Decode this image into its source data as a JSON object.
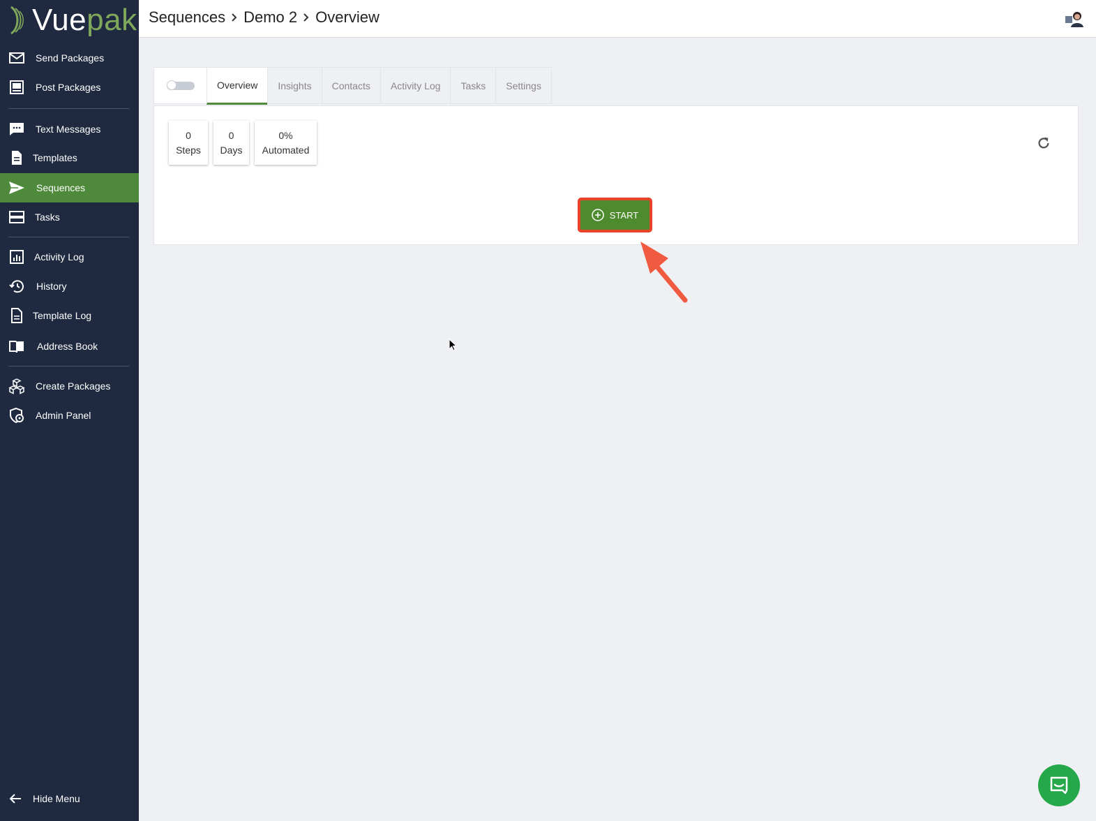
{
  "brand": {
    "part1": "Vue",
    "part2": "pak"
  },
  "sidebar": {
    "items": [
      {
        "label": "Send Packages",
        "icon": "mail-icon"
      },
      {
        "label": "Post Packages",
        "icon": "post-icon"
      },
      {
        "label": "Text Messages",
        "icon": "chat-bubble-icon"
      },
      {
        "label": "Templates",
        "icon": "document-icon"
      },
      {
        "label": "Sequences",
        "icon": "send-icon",
        "active": true
      },
      {
        "label": "Tasks",
        "icon": "tasks-icon"
      },
      {
        "label": "Activity Log",
        "icon": "chart-icon"
      },
      {
        "label": "History",
        "icon": "history-icon"
      },
      {
        "label": "Template Log",
        "icon": "document-outline-icon"
      },
      {
        "label": "Address Book",
        "icon": "book-icon"
      },
      {
        "label": "Create Packages",
        "icon": "boxes-icon"
      },
      {
        "label": "Admin Panel",
        "icon": "admin-shield-icon"
      }
    ],
    "hide_menu": "Hide Menu"
  },
  "breadcrumb": [
    "Sequences",
    "Demo 2",
    "Overview"
  ],
  "tabs": [
    "Overview",
    "Insights",
    "Contacts",
    "Activity Log",
    "Tasks",
    "Settings"
  ],
  "stats": [
    {
      "value": "0",
      "label": "Steps"
    },
    {
      "value": "0",
      "label": "Days"
    },
    {
      "value": "0%",
      "label": "Automated"
    }
  ],
  "start_button": "START",
  "colors": {
    "sidebar_bg": "#1f2a40",
    "active_green": "#4f8a3c",
    "button_green": "#4e8a2e",
    "highlight_red": "#e8422a",
    "chat_green": "#25a84a"
  }
}
